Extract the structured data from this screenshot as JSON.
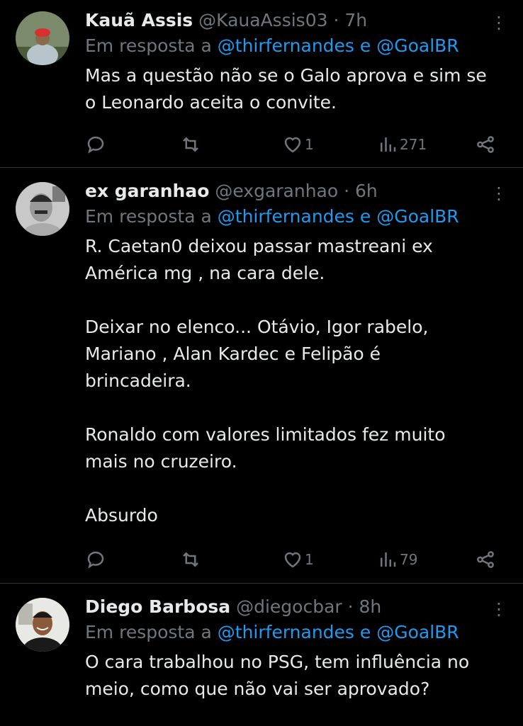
{
  "reply_prefix": "Em resposta a",
  "tweets": [
    {
      "name": "Kauã Assis",
      "handle": "@KauaAssis03",
      "time": "7h",
      "mentions": "@thirfernandes e @GoalBR",
      "text": "Mas a questão não se o Galo aprova e sim se\no Leonardo aceita o convite.",
      "likes": "1",
      "views": "271"
    },
    {
      "name": "ex garanhao",
      "handle": "@exgaranhao",
      "time": "6h",
      "mentions": "@thirfernandes e @GoalBR",
      "text": "R. Caetan0 deixou passar mastreani ex\nAmérica mg , na cara dele.\n\nDeixar no elenco... Otávio, Igor rabelo,\nMariano , Alan Kardec e Felipão é\nbrincadeira.\n\nRonaldo com valores limitados fez muito\nmais no cruzeiro.\n\nAbsurdo",
      "likes": "1",
      "views": "79"
    },
    {
      "name": "Diego Barbosa",
      "handle": "@diegocbar",
      "time": "8h",
      "mentions": "@thirfernandes e @GoalBR",
      "text": "O cara trabalhou no PSG, tem influência no\nmeio, como que não vai ser aprovado?"
    }
  ],
  "dot": "·",
  "more_glyph": "⋮"
}
